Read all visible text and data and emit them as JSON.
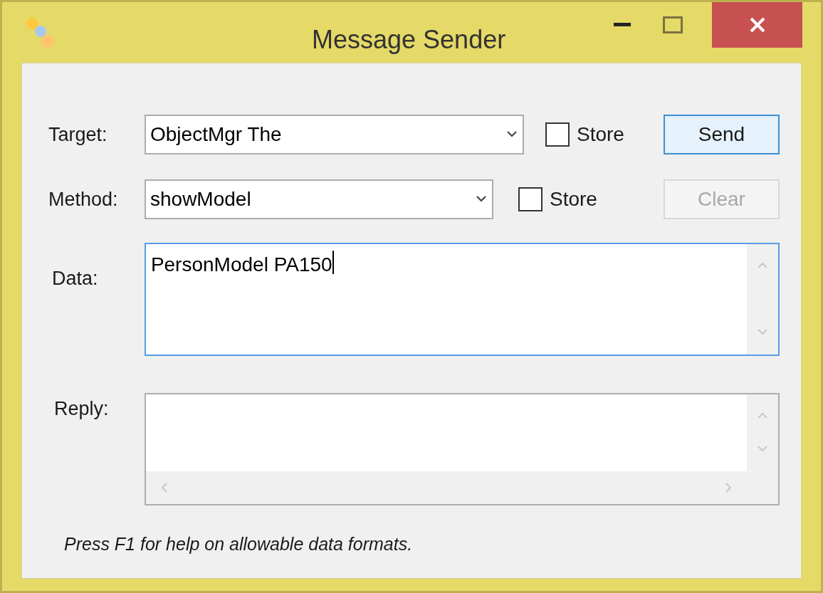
{
  "window": {
    "title": "Message Sender"
  },
  "rows": [
    {
      "label": "Target:",
      "value": "ObjectMgr The",
      "store": {
        "label": "Store",
        "checked": false
      },
      "button": {
        "label": "Send",
        "disabled": false,
        "default": true
      }
    },
    {
      "label": "Method:",
      "value": "showModel",
      "store": {
        "label": "Store",
        "checked": false
      },
      "button": {
        "label": "Clear",
        "disabled": true,
        "default": false
      }
    }
  ],
  "data": {
    "label": "Data:",
    "value": "PersonModel PA150",
    "focused": true
  },
  "reply": {
    "label": "Reply:",
    "focused": false
  },
  "footer": "Press F1 for help on allowable data formats."
}
